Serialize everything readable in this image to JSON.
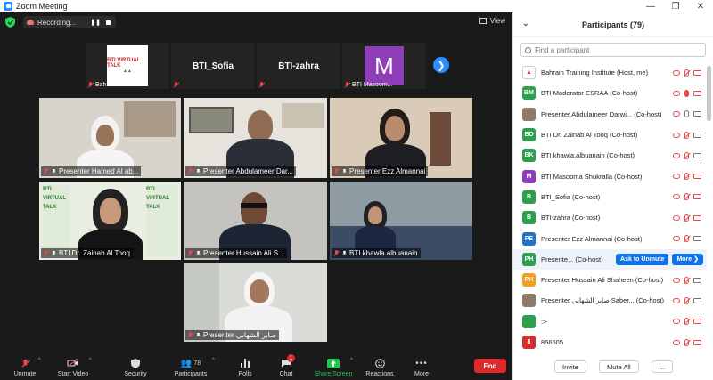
{
  "window": {
    "title": "Zoom Meeting"
  },
  "topbar": {
    "recording_label": "Recording...",
    "view_label": "View"
  },
  "strip": [
    {
      "name": "Bahrain Traini...",
      "kind": "logo",
      "logo_text": "BTI VIRTUAL TALK"
    },
    {
      "name": "",
      "kind": "text",
      "display": "BTI_Sofia"
    },
    {
      "name": "",
      "kind": "text",
      "display": "BTI-zahra"
    },
    {
      "name": "BTI Masoom...",
      "kind": "avatar",
      "display": "M"
    }
  ],
  "tiles": [
    {
      "name": "Presenter Hamed Al ab..."
    },
    {
      "name": "Presenter Abdulameer Dar..."
    },
    {
      "name": "Presenter Ezz Almannai"
    },
    {
      "name": "BTI Dr. Zainab Al Tooq"
    },
    {
      "name": "Presenter Hussain Ali S..."
    },
    {
      "name": "BTI khawla.albuanain"
    },
    {
      "name": "Presenter صابر الشهابي"
    }
  ],
  "toolbar": {
    "unmute": "Unmute",
    "start_video": "Start Video",
    "security": "Security",
    "participants": "Participants",
    "participants_count": "78",
    "polls": "Polls",
    "chat": "Chat",
    "chat_badge": "1",
    "share_screen": "Share Screen",
    "reactions": "Reactions",
    "more": "More",
    "end": "End"
  },
  "panel": {
    "title": "Participants (79)",
    "search_placeholder": "Find a participant",
    "participants": [
      {
        "initials": "",
        "color": "#ffffff",
        "name": "Bahrain Training Institute (Host, me)",
        "mic": "muted",
        "video": "off",
        "logo": true
      },
      {
        "initials": "BM",
        "color": "#2e9e4f",
        "name": "BTI Moderator ESRAA (Co-host)",
        "mic": "on",
        "video": "off"
      },
      {
        "initials": "",
        "color": "#8d7b6a",
        "name": "Presenter Abdulameer Darwi... (Co-host)",
        "mic": "ok",
        "video": "ok",
        "img": true
      },
      {
        "initials": "BD",
        "color": "#2e9e4f",
        "name": "BTI Dr. Zainab Al Tooq (Co-host)",
        "mic": "muted",
        "video": "ok"
      },
      {
        "initials": "BK",
        "color": "#2e9e4f",
        "name": "BTI khawla.albuanain (Co-host)",
        "mic": "muted",
        "video": "ok"
      },
      {
        "initials": "M",
        "color": "#8e3fb8",
        "name": "BTI Masooma Shukralla (Co-host)",
        "mic": "muted",
        "video": "off"
      },
      {
        "initials": "B",
        "color": "#2e9e4f",
        "name": "BTI_Sofia (Co-host)",
        "mic": "muted",
        "video": "off"
      },
      {
        "initials": "B",
        "color": "#2e9e4f",
        "name": "BTI-zahra (Co-host)",
        "mic": "muted",
        "video": "off"
      },
      {
        "initials": "PE",
        "color": "#1e73c8",
        "name": "Presenter Ezz Almannai (Co-host)",
        "mic": "muted",
        "video": "ok"
      },
      {
        "initials": "PH",
        "color": "#2e9e4f",
        "name": "Presente... (Co-host)",
        "mic": "",
        "video": "",
        "buttons": true
      },
      {
        "initials": "PH",
        "color": "#f0a020",
        "name": "Presenter Hussain Ali Shaheen (Co-host)",
        "mic": "muted",
        "video": "ok"
      },
      {
        "initials": "",
        "color": "#8d7b6a",
        "name": "Presenter صابر الشهابي Saber... (Co-host)",
        "mic": "muted",
        "video": "ok",
        "img": true
      },
      {
        "initials": "",
        "color": "#2e9e4f",
        "name": ":>",
        "mic": "muted",
        "video": "off",
        "img": true
      },
      {
        "initials": "8",
        "color": "#d32f2f",
        "name": "866605",
        "mic": "muted",
        "video": "off"
      }
    ],
    "ask_unmute": "Ask to Unmute",
    "more_btn": "More ❯",
    "invite": "Invite",
    "mute_all": "Mute All",
    "ellipsis": "..."
  }
}
